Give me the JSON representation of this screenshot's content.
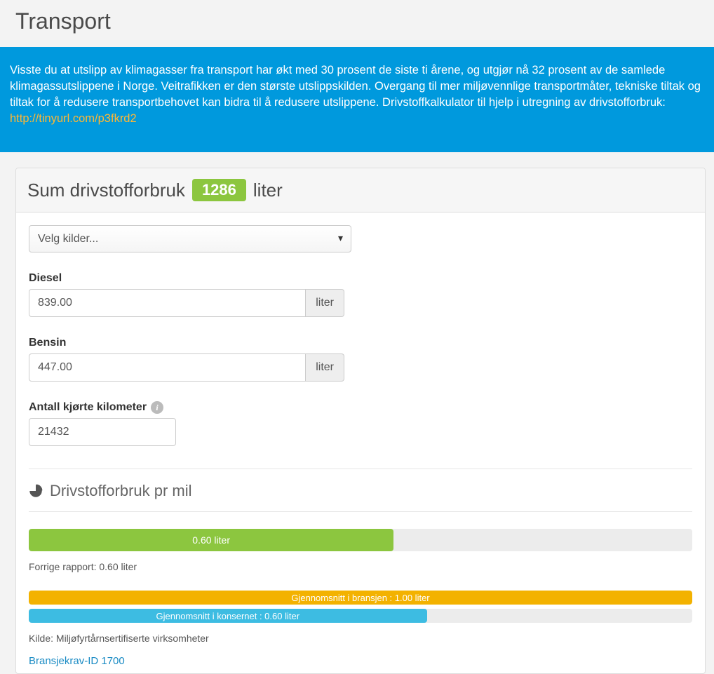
{
  "page": {
    "title": "Transport"
  },
  "banner": {
    "text": "Visste du at utslipp av klimagasser fra transport har økt med 30 prosent de siste ti årene, og utgjør nå 32 prosent av de samlede klimagassutslippene i Norge. Veitrafikken er den største utslippskilden. Overgang til mer miljøvennlige transportmåter, tekniske tiltak og tiltak for å redusere transportbehovet kan bidra til å redusere utslippene. Drivstoffkalkulator til hjelp i utregning av drivstofforbruk: ",
    "link_text": "http://tinyurl.com/p3fkrd2"
  },
  "panel": {
    "header_prefix": "Sum drivstofforbruk",
    "header_value": "1286",
    "header_suffix": "liter",
    "source_select": {
      "placeholder": "Velg kilder..."
    },
    "fields": {
      "diesel": {
        "label": "Diesel",
        "value": "839.00",
        "unit": "liter"
      },
      "bensin": {
        "label": "Bensin",
        "value": "447.00",
        "unit": "liter"
      },
      "km": {
        "label": "Antall kjørte kilometer",
        "value": "21432"
      }
    },
    "per_mil": {
      "heading": "Drivstofforbruk pr mil",
      "current": {
        "label": "0.60 liter",
        "pct": 55
      },
      "previous_caption": "Forrige rapport: 0.60 liter",
      "industry": {
        "label": "Gjennomsnitt i bransjen : 1.00 liter",
        "pct": 100
      },
      "group": {
        "label": "Gjennomsnitt i konsernet : 0.60 liter",
        "pct": 60
      },
      "source_caption": "Kilde: Miljøfyrtårnsertifiserte virksomheter",
      "req_link": "Bransjekrav-ID 1700"
    }
  }
}
